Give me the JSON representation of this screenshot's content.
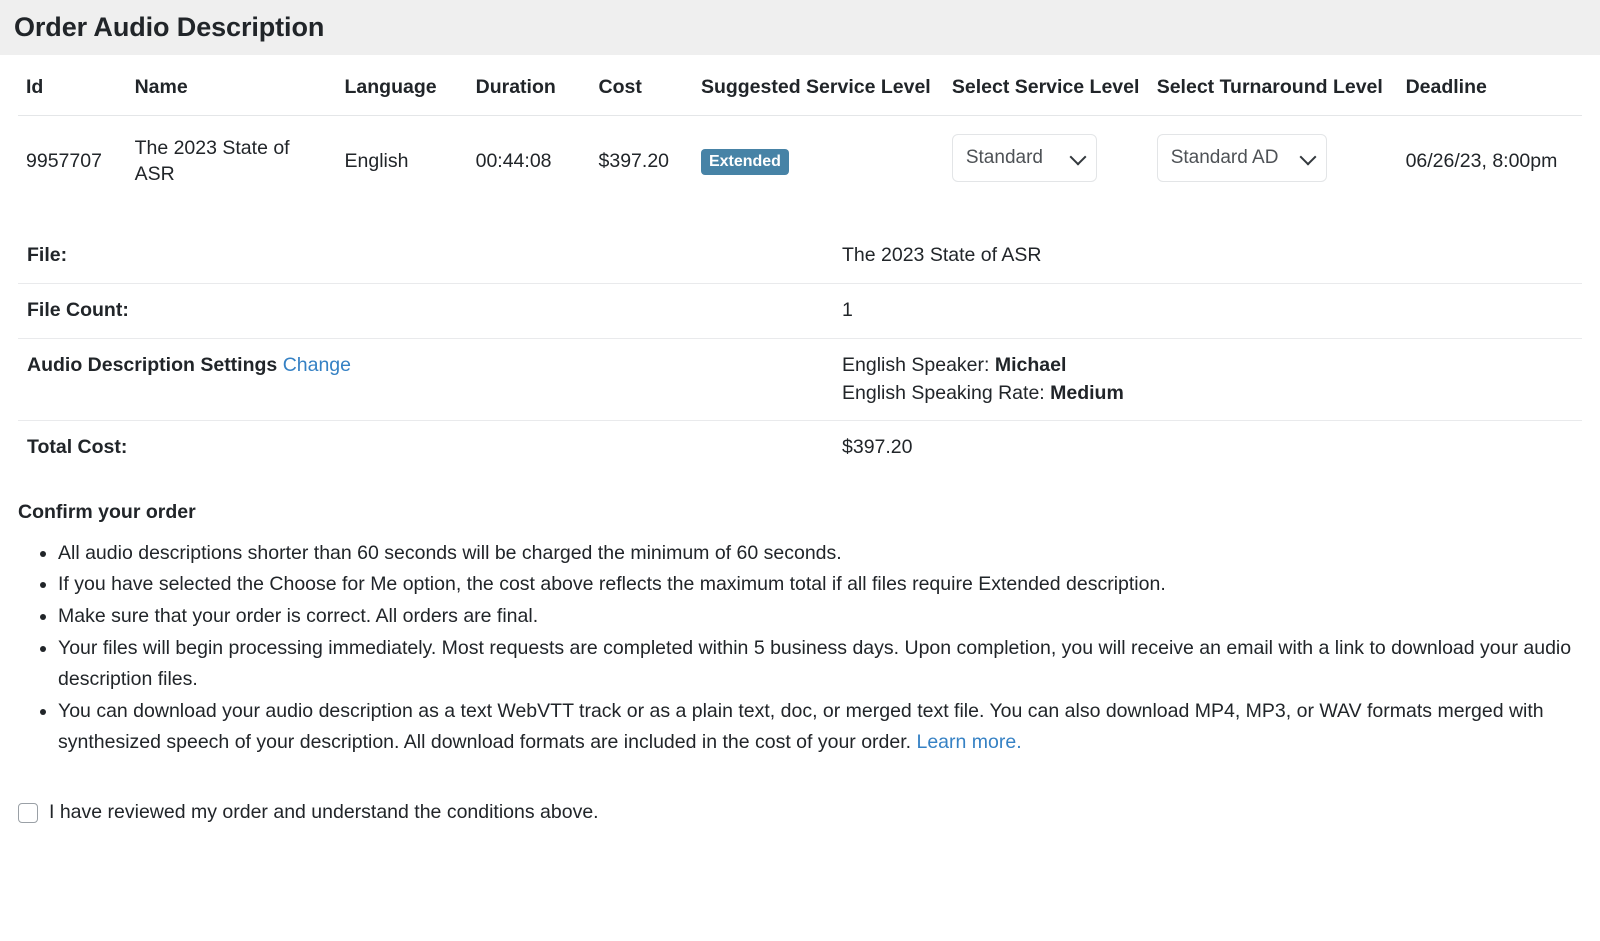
{
  "header": {
    "title": "Order Audio Description"
  },
  "order_table": {
    "columns": [
      "Id",
      "Name",
      "Language",
      "Duration",
      "Cost",
      "Suggested Service Level",
      "Select Service Level",
      "Select Turnaround Level",
      "Deadline"
    ],
    "row": {
      "id": "9957707",
      "name": "The 2023 State of ASR",
      "language": "English",
      "duration": "00:44:08",
      "cost": "$397.20",
      "suggested_service_level": "Extended",
      "select_service_level": "Standard",
      "select_turnaround_level": "Standard AD",
      "deadline": "06/26/23, 8:00pm"
    }
  },
  "details": {
    "file_label": "File:",
    "file_value": "The 2023 State of ASR",
    "file_count_label": "File Count:",
    "file_count_value": "1",
    "settings_label": "Audio Description Settings",
    "settings_change_link": "Change",
    "settings_speaker": "English Speaker:",
    "settings_speaker_value": "Michael",
    "settings_rate": "English Speaking Rate:",
    "settings_rate_value": "Medium",
    "total_cost_label": "Total Cost:",
    "total_cost_value": "$397.20"
  },
  "confirm": {
    "title": "Confirm your order",
    "conditions": [
      "All audio descriptions shorter than 60 seconds will be charged the minimum of 60 seconds.",
      "If you have selected the Choose for Me option, the cost above reflects the maximum total if all files require Extended description.",
      "Make sure that your order is correct. All orders are final.",
      "Your files will begin processing immediately. Most requests are completed within 5 business days. Upon completion, you will receive an email with a link to download your audio description files."
    ],
    "last_condition_text": "You can download your audio description as a text WebVTT track or as a plain text, doc, or merged text file. You can also download MP4, MP3, or WAV formats merged with synthesized speech of your description. All download formats are included in the cost of your order.",
    "learn_more_link": "Learn more.",
    "checkbox_label": "I have reviewed my order and understand the conditions above."
  },
  "colors": {
    "header_bg": "#efefef",
    "badge_bg": "#4783a6",
    "link": "#3581c4",
    "text": "#212529",
    "border": "#e9eaec"
  }
}
